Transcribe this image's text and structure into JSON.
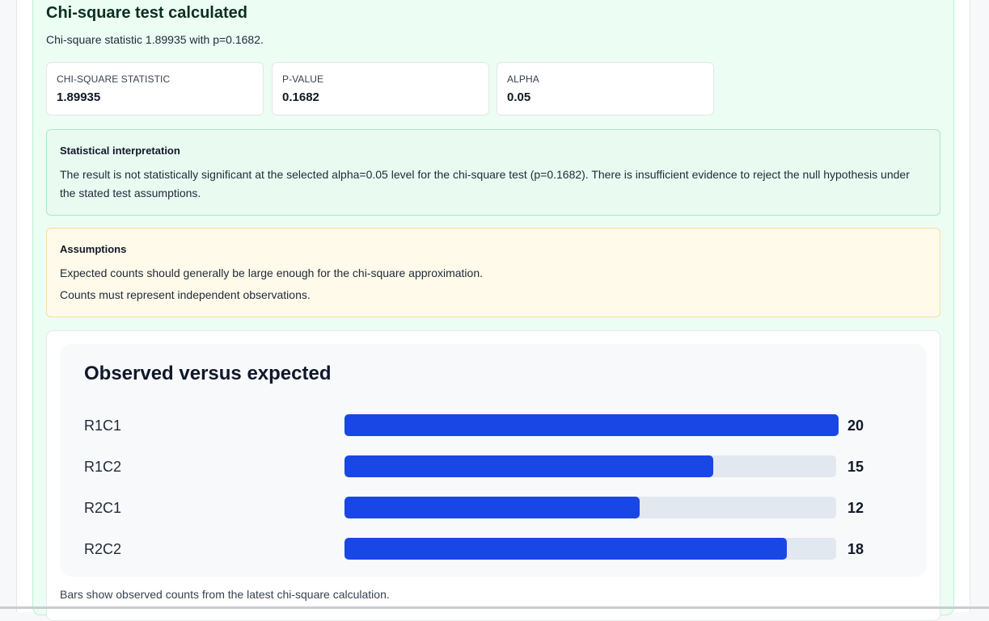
{
  "result": {
    "title": "Chi-square test calculated",
    "summary": "Chi-square statistic 1.89935 with p=0.1682."
  },
  "stats": [
    {
      "label": "CHI-SQUARE STATISTIC",
      "value": "1.89935"
    },
    {
      "label": "P-VALUE",
      "value": "0.1682"
    },
    {
      "label": "ALPHA",
      "value": "0.05"
    }
  ],
  "interpretation": {
    "heading": "Statistical interpretation",
    "text": "The result is not statistically significant at the selected alpha=0.05 level for the chi-square test (p=0.1682). There is insufficient evidence to reject the null hypothesis under the stated test assumptions."
  },
  "assumptions": {
    "heading": "Assumptions",
    "items": [
      "Expected counts should generally be large enough for the chi-square approximation.",
      "Counts must represent independent observations."
    ]
  },
  "chart_data": {
    "type": "bar",
    "title": "Observed versus expected",
    "categories": [
      "R1C1",
      "R1C2",
      "R2C1",
      "R2C2"
    ],
    "values": [
      20,
      15,
      12,
      18
    ],
    "value_labels": [
      "20",
      "15",
      "12",
      "18"
    ],
    "max": 20,
    "orientation": "horizontal",
    "bar_color": "#1947e5",
    "track_color": "#e2e8f0",
    "caption": "Bars show observed counts from the latest chi-square calculation."
  }
}
